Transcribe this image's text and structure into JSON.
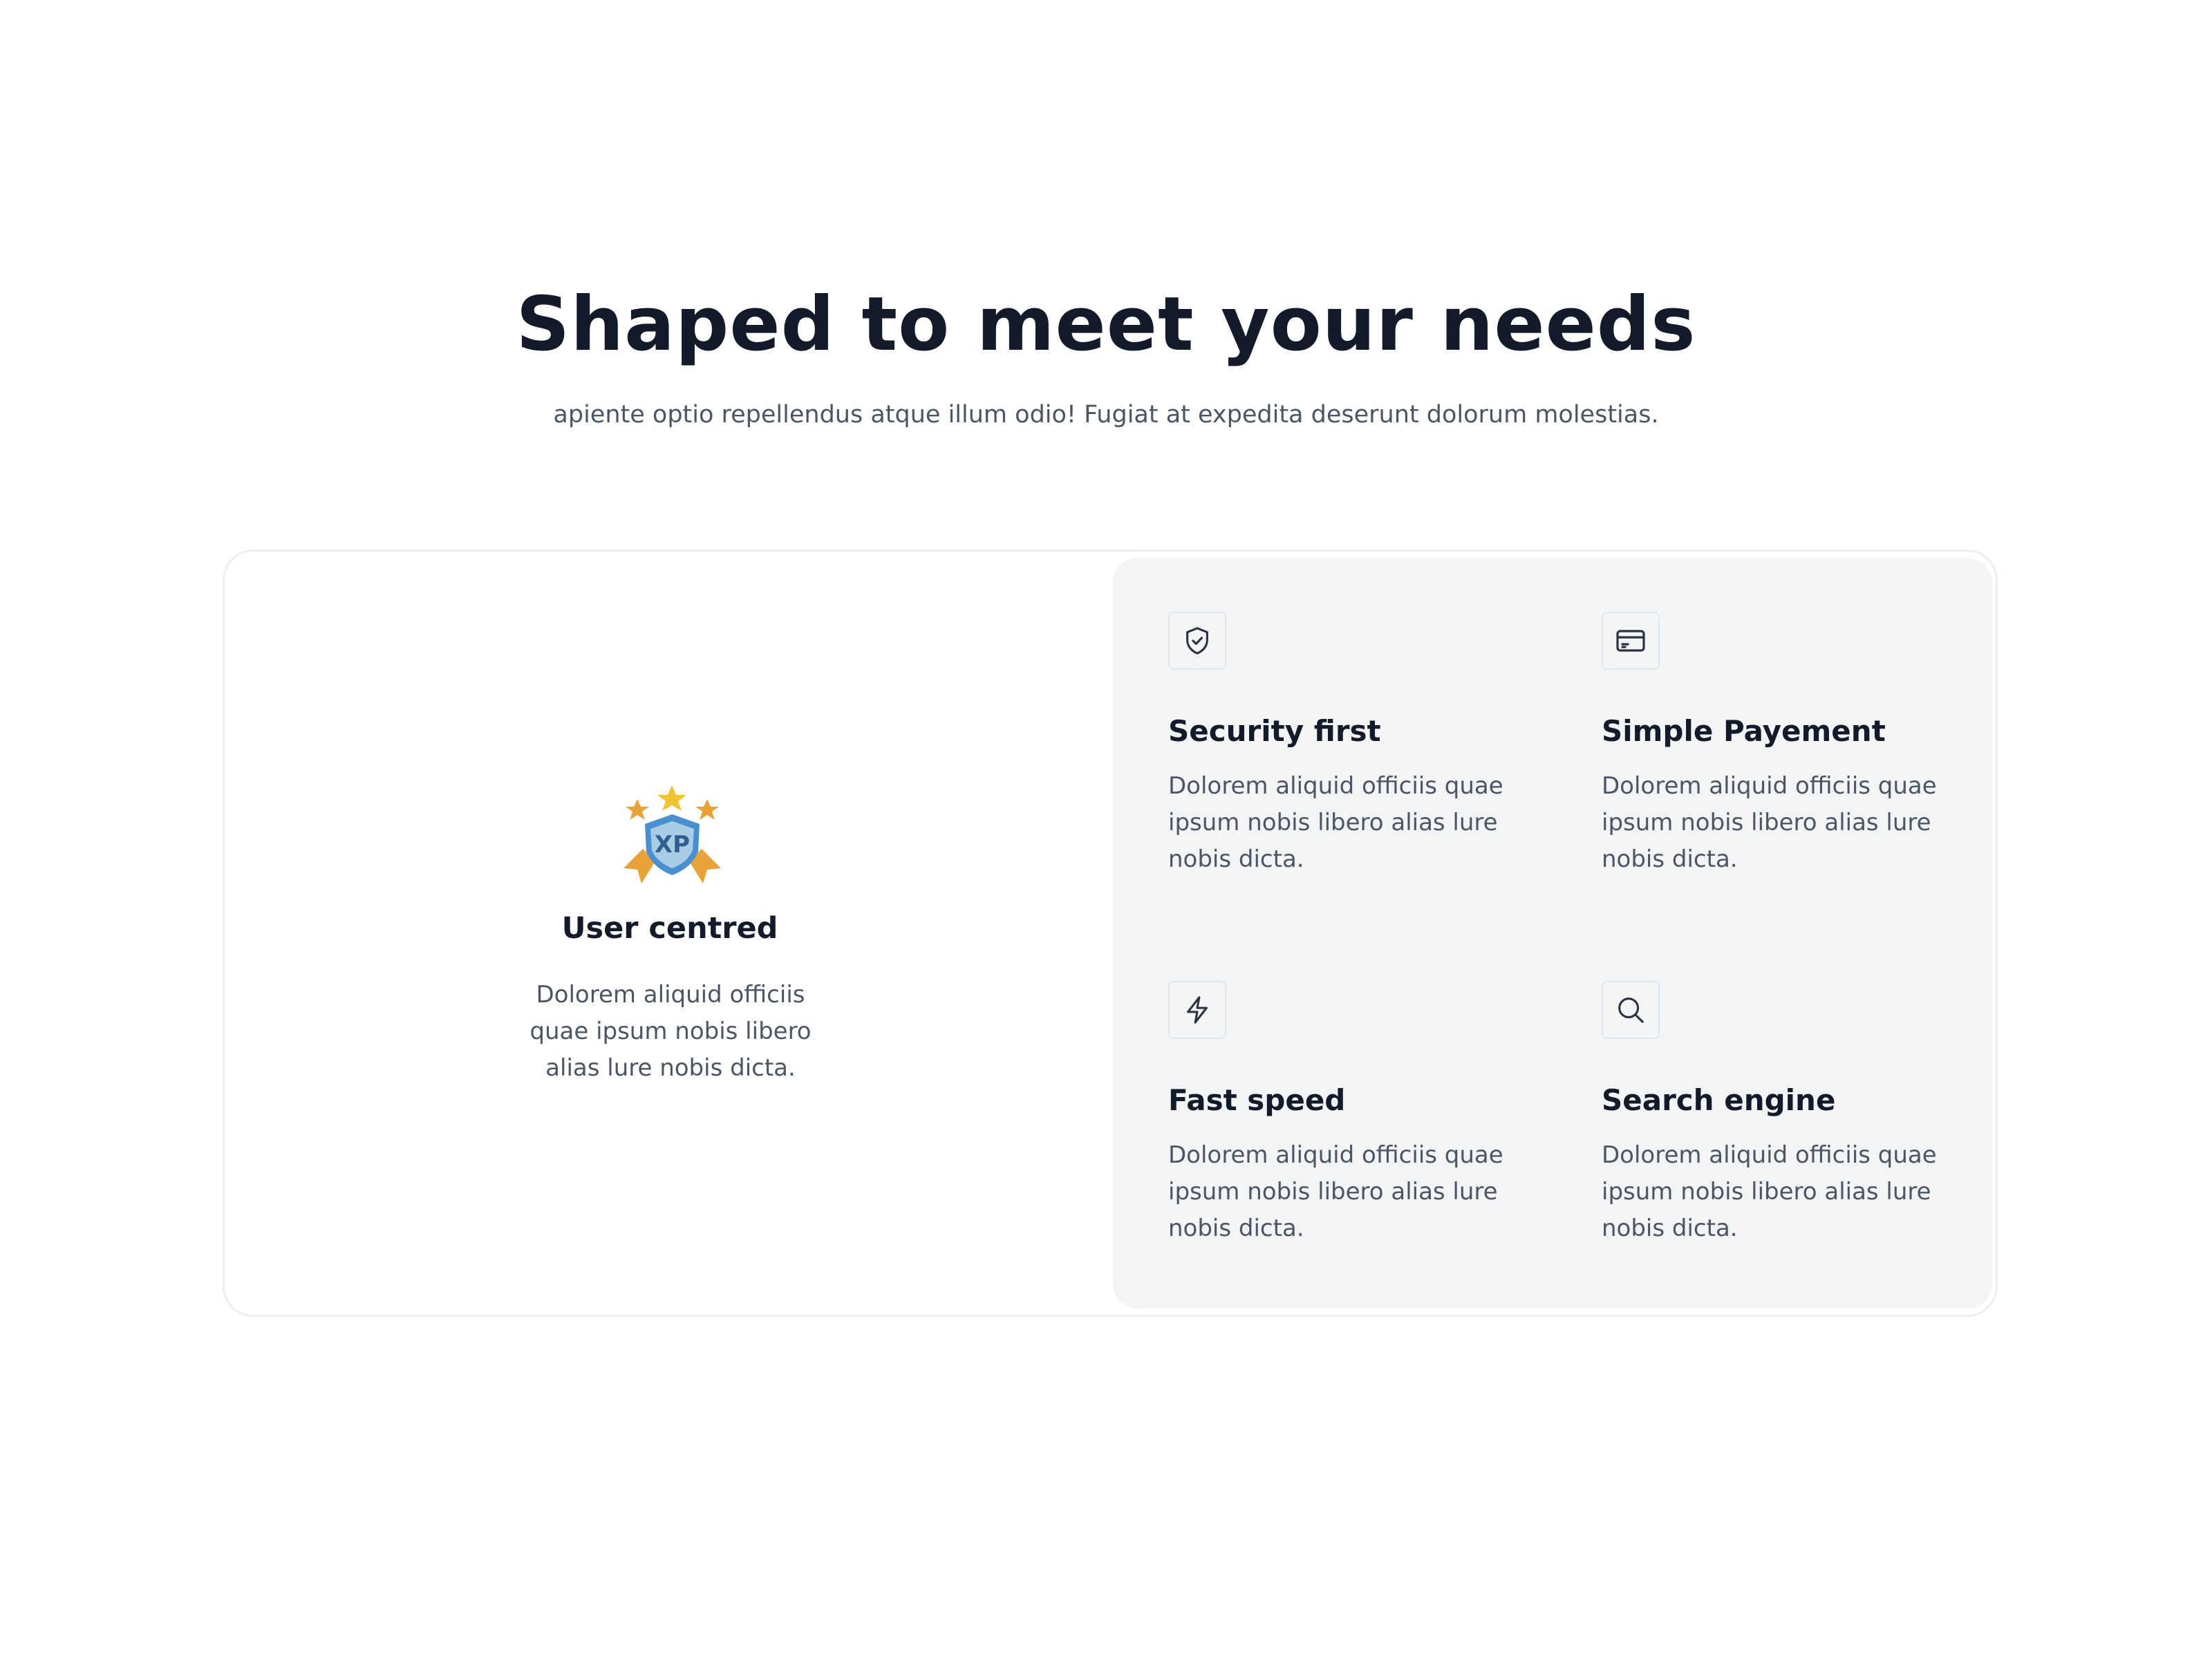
{
  "header": {
    "title": "Shaped to meet your needs",
    "subtitle": "apiente optio repellendus atque illum odio! Fugiat at expedita deserunt dolorum molestias."
  },
  "highlight": {
    "icon": "xp-badge-icon",
    "badge_text": "XP",
    "title": "User centred",
    "description": "Dolorem aliquid officiis quae ipsum nobis libero alias lure nobis dicta."
  },
  "features": [
    {
      "icon": "shield-check-icon",
      "title": "Security first",
      "description": "Dolorem aliquid officiis quae ipsum nobis libero alias lure nobis dicta."
    },
    {
      "icon": "credit-card-icon",
      "title": "Simple Payement",
      "description": "Dolorem aliquid officiis quae ipsum nobis libero alias lure nobis dicta."
    },
    {
      "icon": "lightning-bolt-icon",
      "title": "Fast speed",
      "description": "Dolorem aliquid officiis quae ipsum nobis libero alias lure nobis dicta."
    },
    {
      "icon": "search-icon",
      "title": "Search engine",
      "description": "Dolorem aliquid officiis quae ipsum nobis libero alias lure nobis dicta."
    }
  ],
  "colors": {
    "heading": "#131a2a",
    "body_text": "#4b5563",
    "panel_background": "#f2f4f6",
    "card_border": "#eceef1",
    "badge_blue": "#4a8fcf",
    "badge_gold": "#e8a23a"
  }
}
